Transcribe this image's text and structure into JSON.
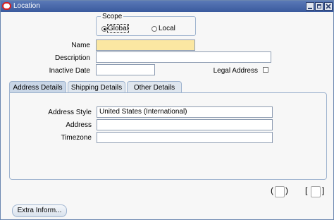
{
  "window": {
    "title": "Location"
  },
  "scope": {
    "label": "Scope",
    "options": [
      {
        "label": "Global",
        "selected": true
      },
      {
        "label": "Local",
        "selected": false
      }
    ]
  },
  "form": {
    "name_label": "Name",
    "name_value": "",
    "description_label": "Description",
    "description_value": "",
    "inactive_date_label": "Inactive Date",
    "inactive_date_value": "",
    "legal_address_label": "Legal Address",
    "legal_address_checked": false
  },
  "tabs": [
    {
      "label": "Address Details",
      "active": true
    },
    {
      "label": "Shipping Details",
      "active": false
    },
    {
      "label": "Other Details",
      "active": false
    }
  ],
  "address": {
    "style_label": "Address Style",
    "style_value": "United States (International)",
    "address_label": "Address",
    "address_value": "",
    "timezone_label": "Timezone",
    "timezone_value": ""
  },
  "footer": {
    "left_paren": "(",
    "right_paren": ")",
    "left_bracket": "[",
    "right_bracket": "]",
    "extra_button_label": "Extra Inform..."
  },
  "colors": {
    "title_bar": "#3a5a9e",
    "required_field": "#fbe7a2",
    "tab_active": "#c9d6e6"
  }
}
